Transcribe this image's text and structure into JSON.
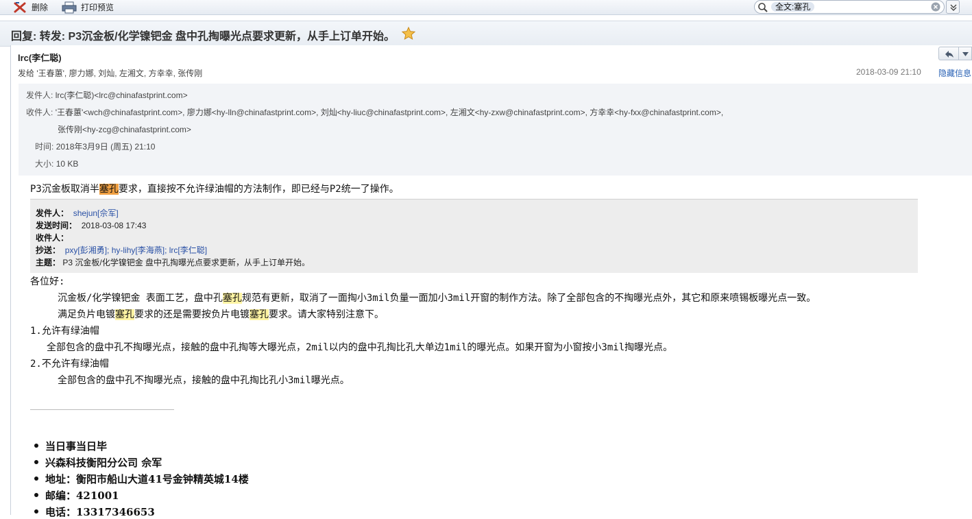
{
  "toolbar": {
    "delete_label": "删除",
    "print_label": "打印预览",
    "search_token": "全文:塞孔"
  },
  "message": {
    "subject": "回复: 转发: P3沉金板/化学镍钯金 盘中孔掏曝光点要求更新，从手上订单开始。",
    "sender_name": "lrc(李仁聪)",
    "recipients_summary": "发给 '王春蕙', 廖力娜, 刘灿, 左湘文, 方幸幸, 张传刚",
    "date": "2018-03-09 21:10",
    "hide_info": "隐藏信息",
    "details": {
      "from_label": "发件人:",
      "from_value": "lrc(李仁聪)<lrc@chinafastprint.com>",
      "to_label": "收件人:",
      "to_value_1": "'王春蕙'<wch@chinafastprint.com>, 廖力娜<hy-lln@chinafastprint.com>, 刘灿<hy-liuc@chinafastprint.com>, 左湘文<hy-zxw@chinafastprint.com>, 方幸幸<hy-fxx@chinafastprint.com>,",
      "to_value_2": "张传刚<hy-zcg@chinafastprint.com>",
      "time_label": "时间:",
      "time_value": "2018年3月9日 (周五) 21:10",
      "size_label": "大小:",
      "size_value": "10 KB"
    }
  },
  "body": {
    "intro_pre": "P3沉金板取消半",
    "intro_hl": "塞孔",
    "intro_post": "要求，直接按不允许绿油帽的方法制作，即已经与P2统一了操作。",
    "quote": {
      "from_label": "发件人：",
      "from_value": "shejun[佘军]",
      "sent_label": "发送时间：",
      "sent_value": "2018-03-08 17:43",
      "to_label": "收件人：",
      "cc_label": "抄送：",
      "cc_1": "pxy[彭湘勇]",
      "cc_sep_1": "; ",
      "cc_2": "hy-lihy[李海燕]",
      "cc_sep_2": "; ",
      "cc_3": "lrc[李仁聪]",
      "subject_label": "主题：",
      "subject_value": "P3 沉金板/化学镍钯金 盘中孔掏曝光点要求更新，从手上订单开始。"
    },
    "greeting": "各位好:",
    "p1_pre": "沉金板/化学镍钯金 表面工艺，盘中孔",
    "p1_hl": "塞孔",
    "p1_post": "规范有更新，取消了一面掏小3mil负量一面加小3mil开窗的制作方法。除了全部包含的不掏曝光点外，其它和原来喷锡板曝光点一致。",
    "p2_a": "满足负片电镀",
    "p2_hl1": "塞孔",
    "p2_b": "要求的还是需要按负片电镀",
    "p2_hl2": "塞孔",
    "p2_c": "要求。请大家特别注意下。",
    "item1_title": "1.允许有绿油帽",
    "item1_text": "全部包含的盘中孔不掏曝光点，接触的盘中孔掏等大曝光点，2mil以内的盘中孔掏比孔大单边1mil的曝光点。如果开窗为小窗按小3mil掏曝光点。",
    "item2_title": "2.不允许有绿油帽",
    "item2_text": "全部包含的盘中孔不掏曝光点，接触的盘中孔掏比孔小3mil曝光点。"
  },
  "signature": {
    "items": [
      "当日事当日毕",
      "兴森科技衡阳分公司 佘军",
      "地址：衡阳市船山大道41号金钟精英城14楼",
      "邮编：421001",
      "电话：13317346653"
    ]
  }
}
